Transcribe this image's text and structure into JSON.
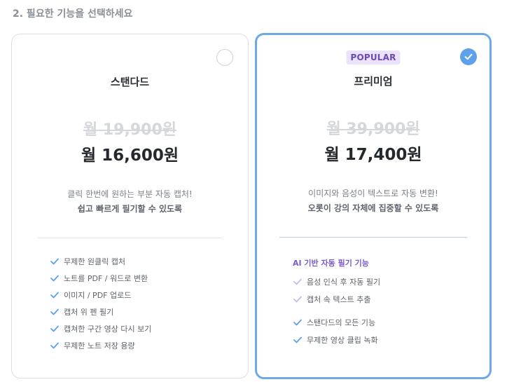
{
  "section": {
    "title": "2. 필요한 기능을 선택하세요"
  },
  "plans": {
    "standard": {
      "name": "스탠다드",
      "old_price": "월 19,900원",
      "new_price": "월 16,600원",
      "desc1": "클릭 한번에 원하는 부분 자동 캡처!",
      "desc2": "쉽고 빠르게 필기할 수 있도록",
      "selected": false,
      "features": [
        "무제한 원클릭 캡처",
        "노트를 PDF / 워드로 변환",
        "이미지 / PDF 업로드",
        "캡처 위 펜 필기",
        "캡쳐한 구간 영상 다시 보기",
        "무제한 노트 저장 용량"
      ]
    },
    "premium": {
      "badge": "POPULAR",
      "name": "프리미엄",
      "old_price": "월 39,900원",
      "new_price": "월 17,400원",
      "desc1": "이미지와 음성이 텍스트로 자동 변환!",
      "desc2": "오롯이 강의 자체에 집중할 수 있도록",
      "selected": true,
      "ai_title": "AI 기반 자동 필기 기능",
      "ai_features": [
        "음성 인식 후 자동 필기",
        "캡처 속 텍스트 추출"
      ],
      "features": [
        "스탠다드의 모든 기능",
        "무제한 영상 클립 녹화"
      ]
    }
  },
  "colors": {
    "accent_blue": "#5ea1ea",
    "border_selected": "#6ea8e6",
    "badge_bg": "#ebe3fb",
    "badge_text": "#6b4ab7",
    "ai_check": "#c9b8ee",
    "check": "#5ea1ea"
  },
  "icons": {
    "radio_checked": "check-circle-icon",
    "feature": "check-icon"
  }
}
